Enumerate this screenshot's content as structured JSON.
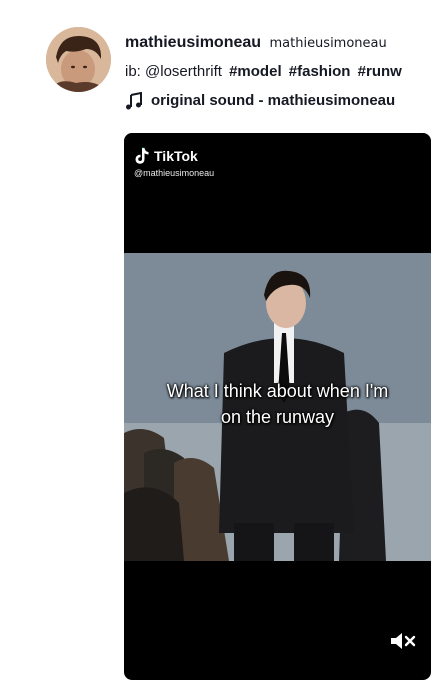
{
  "author": {
    "username": "mathieusimoneau",
    "nickname": "mathieusimoneau"
  },
  "caption": {
    "prefix": "ib: @loserthrift",
    "hashtags": [
      "#model",
      "#fashion",
      "#runw"
    ]
  },
  "music": {
    "icon": "music-note-icon",
    "label": "original sound - mathieusimoneau"
  },
  "video": {
    "watermark_brand": "TikTok",
    "watermark_handle": "@mathieusimoneau",
    "subtitle_line1": "What I think about when I'm",
    "subtitle_line2": "on the runway",
    "mute_icon": "speaker-muted-icon"
  },
  "colors": {
    "text": "#161823",
    "video_bg": "#000000"
  }
}
